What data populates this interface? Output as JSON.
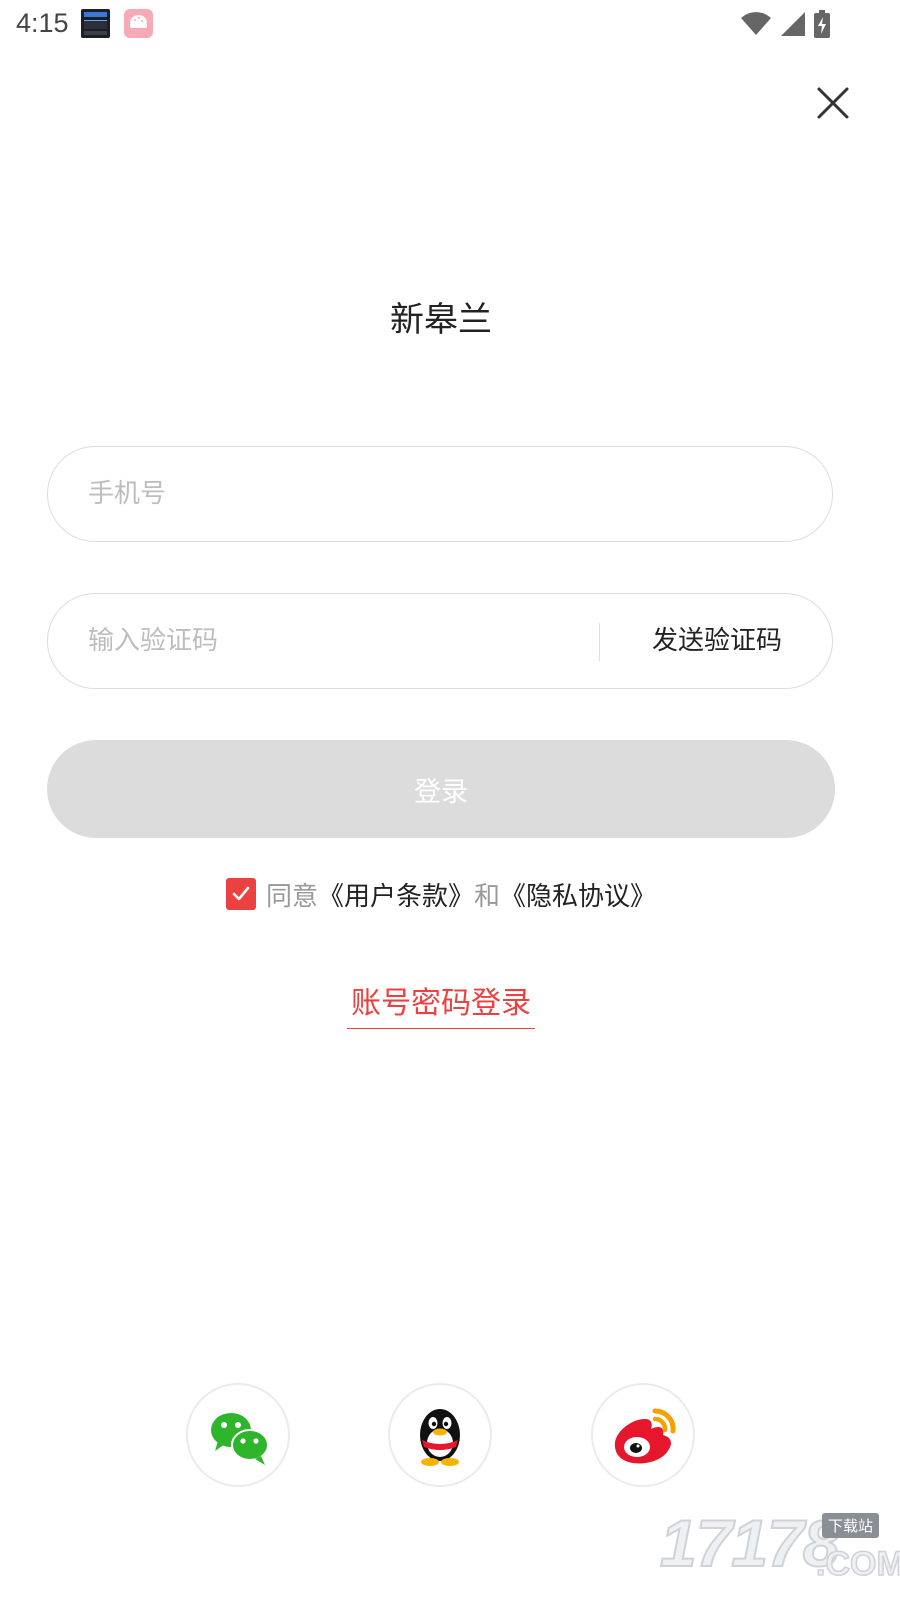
{
  "status_bar": {
    "time": "4:15",
    "app_icons": [
      "clock-widget-icon",
      "rice-bowl-app-icon"
    ],
    "system_icons": [
      "wifi-icon",
      "signal-icon",
      "battery-charging-icon"
    ]
  },
  "header": {
    "close_icon": "close-icon"
  },
  "app": {
    "title": "新皋兰"
  },
  "form": {
    "phone_placeholder": "手机号",
    "phone_value": "",
    "code_placeholder": "输入验证码",
    "code_value": "",
    "send_code_label": "发送验证码",
    "login_label": "登录"
  },
  "agreement": {
    "checked": true,
    "prefix": "同意",
    "terms": "《用户条款》",
    "conjunction": "和",
    "privacy": "《隐私协议》"
  },
  "alt_login": {
    "password_login_label": "账号密码登录"
  },
  "social_login": {
    "items": [
      {
        "name": "wechat-icon"
      },
      {
        "name": "qq-icon"
      },
      {
        "name": "weibo-icon"
      }
    ]
  },
  "watermark": {
    "brand": "17178",
    "tag": "下载站",
    "domain": ".COM"
  },
  "colors": {
    "accent": "#ec4141",
    "button_disabled": "#dcdcdc",
    "placeholder": "#bdbdbd",
    "border": "#dcdcdc",
    "wechat": "#2fb52b",
    "weibo": "#e6162d"
  }
}
